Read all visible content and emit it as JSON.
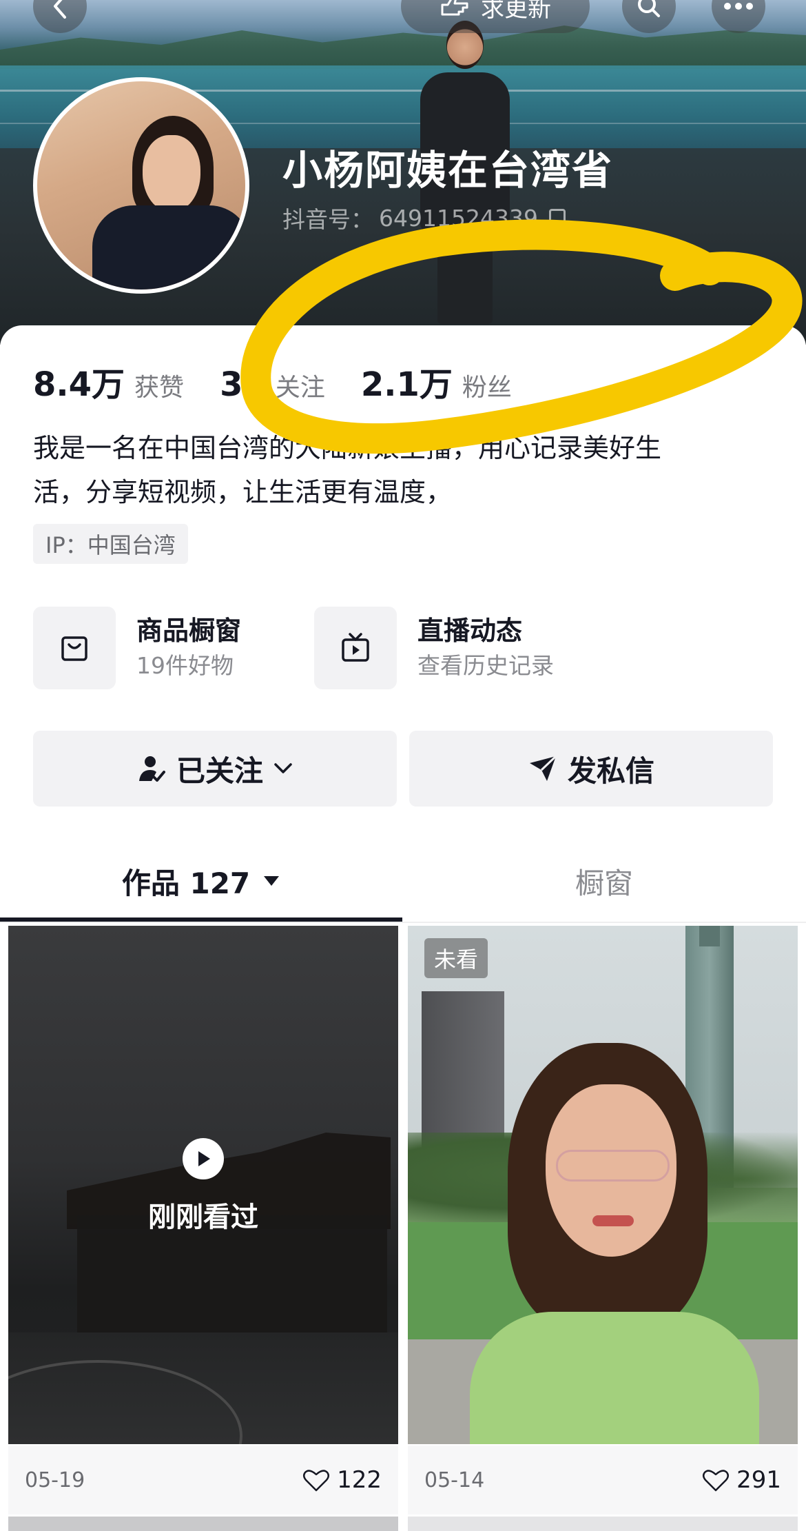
{
  "header": {
    "update_label": "求更新",
    "nickname": "小杨阿姨在台湾省",
    "douyin_id_label": "抖音号：",
    "douyin_id": "64911524339"
  },
  "stats": [
    {
      "value": "8.4万",
      "label": "获赞"
    },
    {
      "value": "35",
      "label": "关注"
    },
    {
      "value": "2.1万",
      "label": "粉丝"
    }
  ],
  "bio": {
    "line1": "我是一名在中国台湾的大陆新娘主播，用心记录美好生",
    "line2": "活，分享短视频，让生活更有温度，"
  },
  "ip_tag": "IP：中国台湾",
  "features": {
    "shop": {
      "title": "商品橱窗",
      "subtitle": "19件好物",
      "icon": "shopping-bag-icon"
    },
    "live": {
      "title": "直播动态",
      "subtitle": "查看历史记录",
      "icon": "tv-icon"
    }
  },
  "actions": {
    "follow_label": "已关注",
    "message_label": "发私信"
  },
  "tabs": {
    "works_label": "作品 127",
    "window_label": "橱窗"
  },
  "videos": [
    {
      "overlay_label": "刚刚看过",
      "date": "05-19",
      "likes": "122"
    },
    {
      "tag": "未看",
      "date": "05-14",
      "likes": "291"
    }
  ],
  "colors": {
    "annotation": "#f7c800",
    "text_primary": "#161823",
    "text_secondary": "#7a7b80",
    "surface": "#f2f2f4"
  }
}
